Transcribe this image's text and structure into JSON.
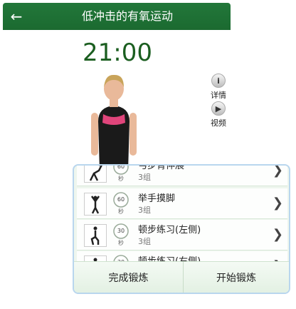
{
  "header": {
    "title": "低冲击的有氧运动",
    "back_icon": "arrow-left-icon"
  },
  "timer": "21:00",
  "side": {
    "details_label": "详情",
    "video_label": "视频"
  },
  "exercises": [
    {
      "name": "弓步背伸展",
      "duration": "60",
      "unit": "秒",
      "sets": "3组"
    },
    {
      "name": "举手摸脚",
      "duration": "60",
      "unit": "秒",
      "sets": "3组"
    },
    {
      "name": "顿步练习(左侧)",
      "duration": "30",
      "unit": "秒",
      "sets": "3组"
    },
    {
      "name": "顿步练习(右侧)",
      "duration": "30",
      "unit": "秒",
      "sets": ""
    }
  ],
  "actions": {
    "finish_label": "完成锻炼",
    "start_label": "开始锻炼"
  },
  "colors": {
    "header": "#1b6a30",
    "timer": "#1b5e20",
    "panel_border": "#b9d6ee"
  }
}
